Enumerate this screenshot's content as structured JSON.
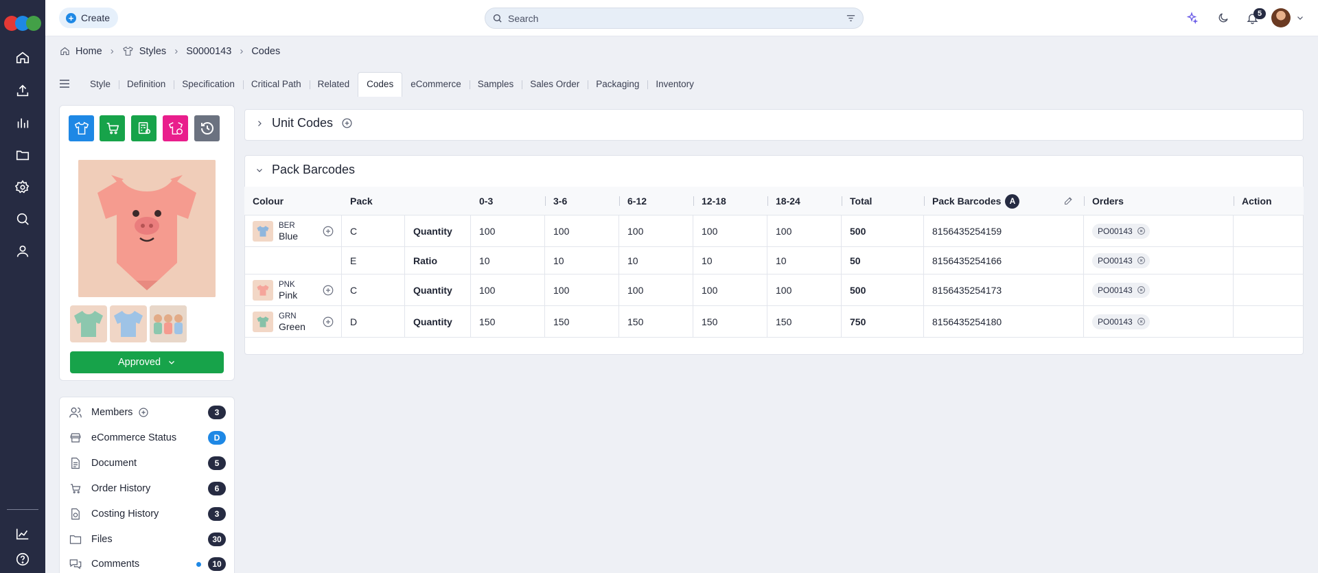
{
  "topbar": {
    "create_label": "Create",
    "search_placeholder": "Search",
    "notification_count": "5"
  },
  "breadcrumb": [
    "Home",
    "Styles",
    "S0000143",
    "Codes"
  ],
  "tabs": [
    "Style",
    "Definition",
    "Specification",
    "Critical Path",
    "Related",
    "Codes",
    "eCommerce",
    "Samples",
    "Sales Order",
    "Packaging",
    "Inventory"
  ],
  "active_tab": "Codes",
  "product": {
    "status_label": "Approved"
  },
  "side_list": [
    {
      "label": "Members",
      "count": "3"
    },
    {
      "label": "eCommerce Status",
      "count": "D"
    },
    {
      "label": "Document",
      "count": "5"
    },
    {
      "label": "Order History",
      "count": "6"
    },
    {
      "label": "Costing History",
      "count": "3"
    },
    {
      "label": "Files",
      "count": "30"
    },
    {
      "label": "Comments",
      "count": "10"
    }
  ],
  "sections": {
    "unit_codes": "Unit Codes",
    "pack_barcodes": "Pack Barcodes"
  },
  "table": {
    "headers": {
      "colour": "Colour",
      "pack": "Pack",
      "s1": "0-3",
      "s2": "3-6",
      "s3": "6-12",
      "s4": "12-18",
      "s5": "18-24",
      "total": "Total",
      "barcodes": "Pack Barcodes",
      "barcodes_badge": "A",
      "orders": "Orders",
      "action": "Action"
    },
    "rows": [
      {
        "code": "BER",
        "name": "Blue",
        "pack": "C",
        "type": "Quantity",
        "s1": "100",
        "s2": "100",
        "s3": "100",
        "s4": "100",
        "s5": "100",
        "total": "500",
        "barcode": "8156435254159",
        "order": "PO00143"
      },
      {
        "code": "",
        "name": "",
        "pack": "E",
        "type": "Ratio",
        "s1": "10",
        "s2": "10",
        "s3": "10",
        "s4": "10",
        "s5": "10",
        "total": "50",
        "barcode": "8156435254166",
        "order": "PO00143"
      },
      {
        "code": "PNK",
        "name": "Pink",
        "pack": "C",
        "type": "Quantity",
        "s1": "100",
        "s2": "100",
        "s3": "100",
        "s4": "100",
        "s5": "100",
        "total": "500",
        "barcode": "8156435254173",
        "order": "PO00143"
      },
      {
        "code": "GRN",
        "name": "Green",
        "pack": "D",
        "type": "Quantity",
        "s1": "150",
        "s2": "150",
        "s3": "150",
        "s4": "150",
        "s5": "150",
        "total": "750",
        "barcode": "8156435254180",
        "order": "PO00143"
      }
    ]
  },
  "colors": {
    "rail": "#262b42",
    "accent_blue": "#1e88e5",
    "approve_green": "#17a34a",
    "tile_pink": "#e91e8c",
    "tile_gray": "#6b7280"
  }
}
